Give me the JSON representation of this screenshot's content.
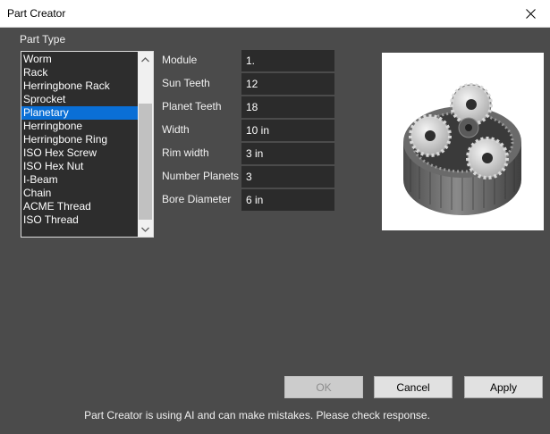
{
  "window": {
    "title": "Part Creator",
    "close_icon": "close-icon"
  },
  "part_type": {
    "label": "Part Type",
    "selected": "Planetary",
    "items": [
      "Worm",
      "Rack",
      "Herringbone Rack",
      "Sprocket",
      "Planetary",
      "Herringbone",
      "Herringbone Ring",
      "ISO Hex Screw",
      "ISO Hex Nut",
      "I-Beam",
      "Chain",
      "ACME Thread",
      "ISO Thread"
    ]
  },
  "fields": [
    {
      "label": "Module",
      "value": "1."
    },
    {
      "label": "Sun Teeth",
      "value": "12"
    },
    {
      "label": "Planet Teeth",
      "value": "18"
    },
    {
      "label": "Width",
      "value": "10 in"
    },
    {
      "label": "Rim width",
      "value": "3 in"
    },
    {
      "label": "Number Planets",
      "value": "3"
    },
    {
      "label": "Bore Diameter",
      "value": "6 in"
    }
  ],
  "preview": {
    "icon": "planetary-gear-preview"
  },
  "buttons": {
    "ok": "OK",
    "cancel": "Cancel",
    "apply": "Apply"
  },
  "footer": {
    "note": "Part Creator is using AI and can make mistakes. Please check response."
  },
  "colors": {
    "dialog_bg": "#4b4b4b",
    "input_bg": "#2b2b2b",
    "selection": "#0a6fd6"
  }
}
